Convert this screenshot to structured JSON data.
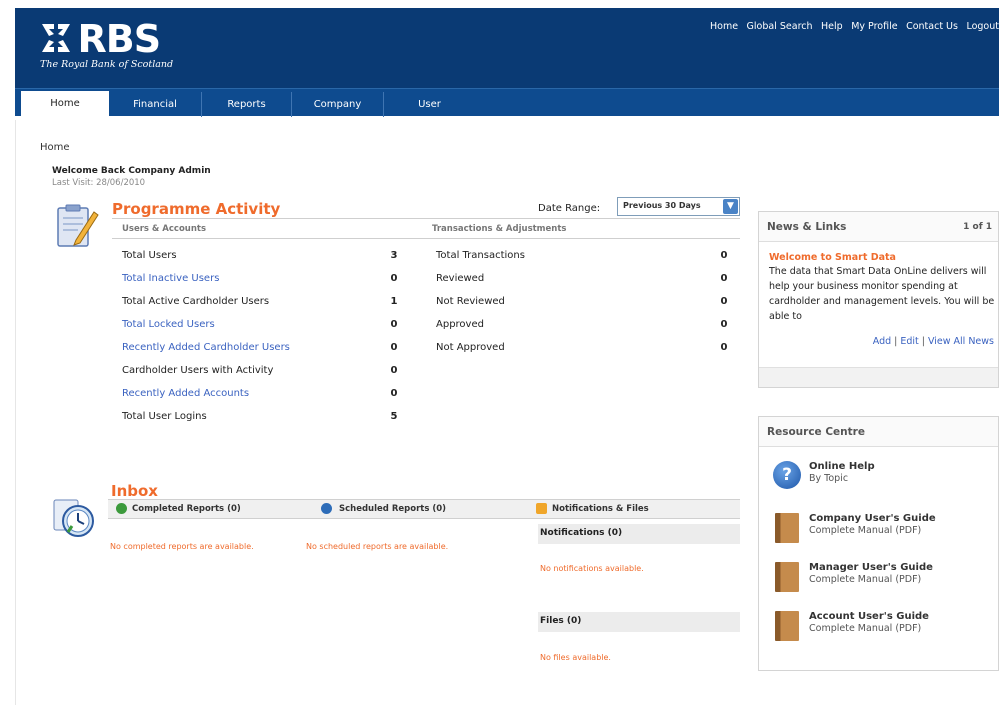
{
  "header": {
    "logo_text": "RBS",
    "logo_sub": "The Royal Bank of Scotland",
    "top_links": [
      "Home",
      "Global Search",
      "Help",
      "My Profile",
      "Contact Us",
      "Logout"
    ]
  },
  "nav": {
    "tabs": [
      "Home",
      "Financial",
      "Reports",
      "Company",
      "User"
    ],
    "active": "Home"
  },
  "breadcrumb": "Home",
  "welcome": {
    "title": "Welcome Back Company Admin",
    "last_visit": "Last Visit: 28/06/2010"
  },
  "activity": {
    "title": "Programme Activity",
    "date_range_label": "Date Range:",
    "date_range_value": "Previous 30 Days",
    "users_header": "Users & Accounts",
    "trans_header": "Transactions & Adjustments",
    "users": [
      {
        "label": "Total Users",
        "value": "3",
        "link": false
      },
      {
        "label": "Total Inactive Users",
        "value": "0",
        "link": true
      },
      {
        "label": "Total Active Cardholder Users",
        "value": "1",
        "link": false
      },
      {
        "label": "Total Locked Users",
        "value": "0",
        "link": true
      },
      {
        "label": "Recently Added Cardholder Users",
        "value": "0",
        "link": true
      },
      {
        "label": "Cardholder Users with Activity",
        "value": "0",
        "link": false
      },
      {
        "label": "Recently Added Accounts",
        "value": "0",
        "link": true
      },
      {
        "label": "Total User Logins",
        "value": "5",
        "link": false
      }
    ],
    "transactions": [
      {
        "label": "Total Transactions",
        "value": "0"
      },
      {
        "label": "Reviewed",
        "value": "0"
      },
      {
        "label": "Not Reviewed",
        "value": "0"
      },
      {
        "label": "Approved",
        "value": "0"
      },
      {
        "label": "Not Approved",
        "value": "0"
      }
    ]
  },
  "inbox": {
    "title": "Inbox",
    "completed_label": "Completed Reports (0)",
    "scheduled_label": "Scheduled Reports (0)",
    "notifications_files_label": "Notifications & Files",
    "completed_msg": "No completed reports are available.",
    "scheduled_msg": "No scheduled reports are available.",
    "notifications_label": "Notifications (0)",
    "notifications_msg": "No notifications available.",
    "files_label": "Files (0)",
    "files_msg": "No files available."
  },
  "news": {
    "title": "News & Links",
    "pages": "1 of 1",
    "item_title": "Welcome to Smart Data",
    "item_body": "The data that Smart Data OnLine delivers will help your business monitor spending at cardholder and management levels. You will be able to",
    "link_add": "Add",
    "link_edit": "Edit",
    "link_view_all": "View All News"
  },
  "resources": {
    "title": "Resource Centre",
    "items": [
      {
        "title": "Online Help",
        "sub": "By Topic",
        "icon": "help-icon"
      },
      {
        "title": "Company User's Guide",
        "sub": "Complete Manual (PDF)",
        "icon": "book-icon"
      },
      {
        "title": "Manager User's Guide",
        "sub": "Complete Manual (PDF)",
        "icon": "book-icon"
      },
      {
        "title": "Account User's Guide",
        "sub": "Complete Manual (PDF)",
        "icon": "book-icon"
      }
    ]
  },
  "colors": {
    "header_bg": "#0a3a74",
    "nav_bg": "#0e4b8f",
    "accent_orange": "#ef6b2c",
    "link_blue": "#3a62c0"
  }
}
